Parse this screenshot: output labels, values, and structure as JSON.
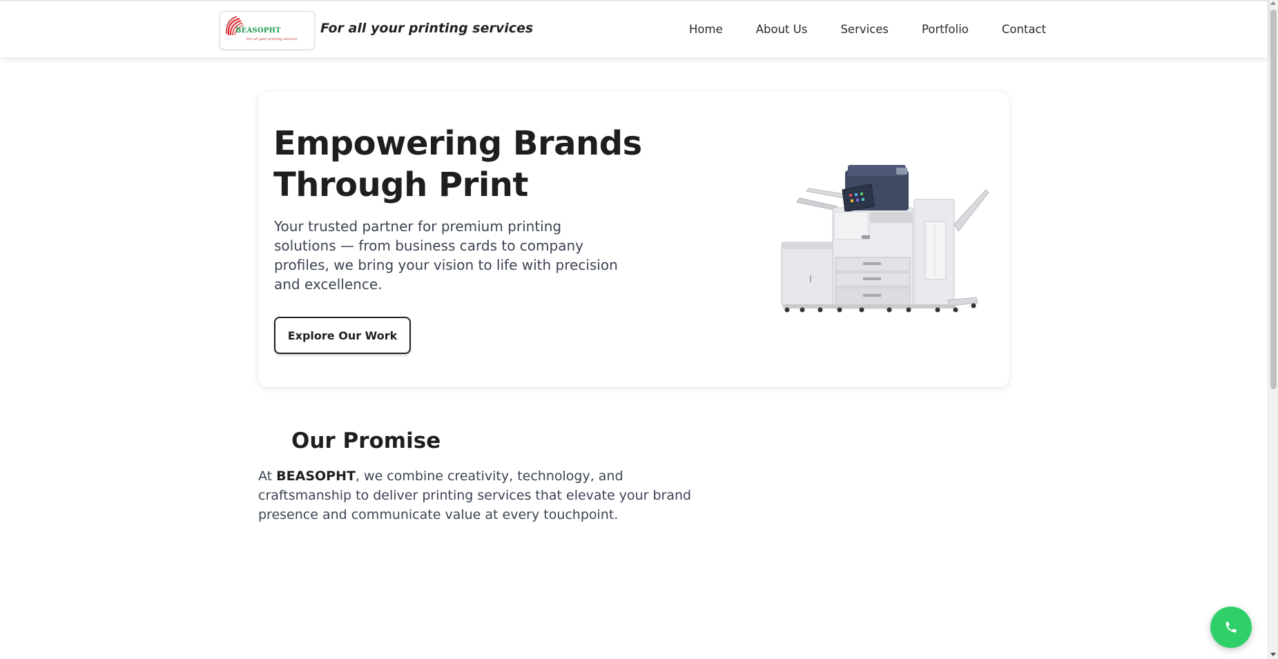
{
  "header": {
    "logo": {
      "name": "BEASOPHT",
      "tagline_small": "For all your printing services",
      "swirl_color": "#d8232a",
      "name_color": "#1b9a4a"
    },
    "tagline": "For all your printing services",
    "nav": [
      {
        "label": "Home"
      },
      {
        "label": "About Us"
      },
      {
        "label": "Services"
      },
      {
        "label": "Portfolio"
      },
      {
        "label": "Contact"
      }
    ]
  },
  "hero": {
    "title_line1": "Empowering Brands",
    "title_line2": "Through Print",
    "subtitle": "Your trusted partner for premium printing solutions — from business cards to company profiles, we bring your vision to life with precision and excellence.",
    "button_label": "Explore Our Work",
    "image_icon": "printer-image"
  },
  "promise": {
    "title": "Our Promise",
    "text_prefix": "At ",
    "brand": "BEASOPHT",
    "text_suffix": ", we combine creativity, technology, and craftsmanship to deliver printing services that elevate your brand presence and communicate value at every touchpoint."
  },
  "floating": {
    "call_icon": "phone-icon",
    "call_color": "#2fd06a"
  }
}
